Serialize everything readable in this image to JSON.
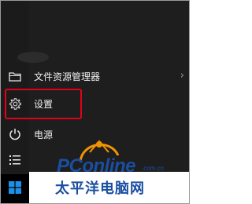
{
  "start_menu": {
    "items": [
      {
        "label": "文件资源管理器",
        "icon": "folder-icon",
        "has_submenu": true
      },
      {
        "label": "设置",
        "icon": "gear-icon",
        "has_submenu": false
      },
      {
        "label": "电源",
        "icon": "power-icon",
        "has_submenu": false
      }
    ],
    "all_apps_icon": "list-icon",
    "start_button_icon": "windows-logo-icon",
    "highlight_color": "#e3001b"
  },
  "watermark": {
    "brand": "PConline",
    "domain": ".com.cn",
    "chinese": "太平洋电脑网",
    "color": "#1a4ea0",
    "accent_color": "#f29400"
  }
}
